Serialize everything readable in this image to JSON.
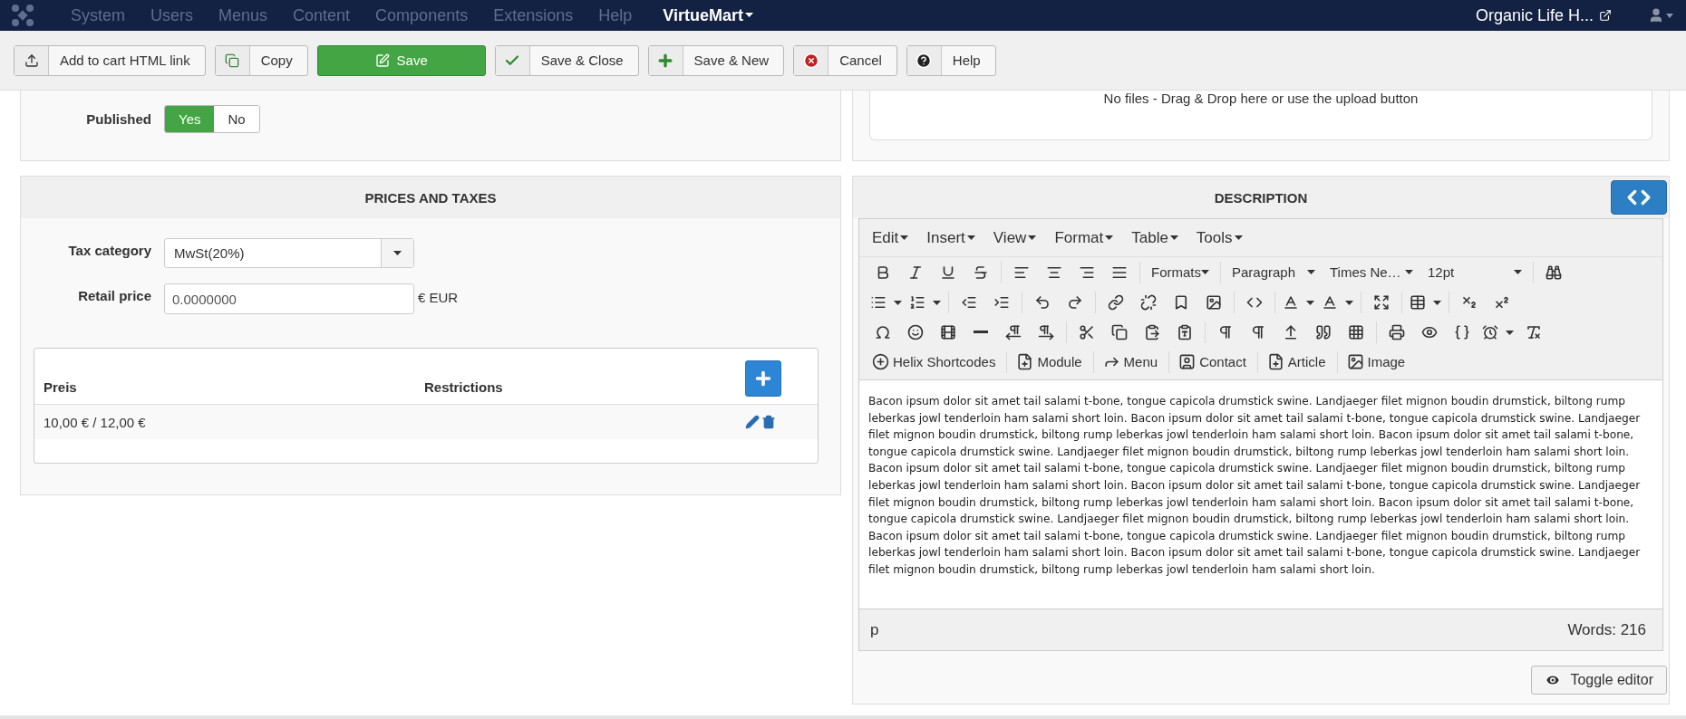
{
  "topbar": {
    "menu": [
      {
        "label": "System",
        "highlighted": false
      },
      {
        "label": "Users",
        "highlighted": false
      },
      {
        "label": "Menus",
        "highlighted": false
      },
      {
        "label": "Content",
        "highlighted": false
      },
      {
        "label": "Components",
        "highlighted": false
      },
      {
        "label": "Extensions",
        "highlighted": false
      },
      {
        "label": "Help",
        "highlighted": false
      },
      {
        "label": "VirtueMart",
        "highlighted": true
      }
    ],
    "site_link": "Organic Life H..."
  },
  "toolbar": [
    {
      "label": "Add to cart HTML link",
      "kind": "upload"
    },
    {
      "label": "Copy",
      "kind": "copy"
    },
    {
      "label": "Save",
      "kind": "save"
    },
    {
      "label": "Save & Close",
      "kind": "check"
    },
    {
      "label": "Save & New",
      "kind": "new"
    },
    {
      "label": "Cancel",
      "kind": "cancel"
    },
    {
      "label": "Help",
      "kind": "help"
    }
  ],
  "details": {
    "published": {
      "label": "Published",
      "options": [
        {
          "label": "Yes",
          "selected": true
        },
        {
          "label": "No",
          "selected": false
        }
      ]
    }
  },
  "prices_and_taxes": {
    "title": "PRICES AND TAXES",
    "tax_category": {
      "label": "Tax category",
      "value": "MwSt(20%)"
    },
    "retail_price": {
      "label": "Retail price",
      "value": "0.0000000",
      "unit": "€ EUR"
    },
    "price_table": {
      "columns": [
        "Preis",
        "Restrictions"
      ],
      "rows": [
        {
          "preis": "10,00 € / 12,00 €"
        }
      ]
    }
  },
  "files": {
    "dropzone": "No files - Drag & Drop here or use the upload button"
  },
  "description": {
    "title": "DESCRIPTION",
    "menus": [
      "Edit",
      "Insert",
      "View",
      "Format",
      "Table",
      "Tools"
    ],
    "formats": "Formats",
    "block": "Paragraph",
    "font": "Times Ne…",
    "size": "12pt",
    "plugins": [
      {
        "label": "Helix Shortcodes",
        "kind": "shortcodes"
      },
      {
        "label": "Module",
        "kind": "module"
      },
      {
        "label": "Menu",
        "kind": "menu"
      },
      {
        "label": "Contact",
        "kind": "contact"
      },
      {
        "label": "Article",
        "kind": "article"
      },
      {
        "label": "Image",
        "kind": "image"
      }
    ],
    "content": "Bacon ipsum dolor sit amet tail salami t-bone, tongue capicola drumstick swine. Landjaeger filet mignon boudin drumstick, biltong rump leberkas jowl tenderloin ham salami short loin. Bacon ipsum dolor sit amet tail salami t-bone, tongue capicola drumstick swine. Landjaeger filet mignon boudin drumstick, biltong rump leberkas jowl tenderloin ham salami short loin. Bacon ipsum dolor sit amet tail salami t-bone, tongue capicola drumstick swine. Landjaeger filet mignon boudin drumstick, biltong rump leberkas jowl tenderloin ham salami short loin. Bacon ipsum dolor sit amet tail salami t-bone, tongue capicola drumstick swine. Landjaeger filet mignon boudin drumstick, biltong rump leberkas jowl tenderloin ham salami short loin. Bacon ipsum dolor sit amet tail salami t-bone, tongue capicola drumstick swine. Landjaeger filet mignon boudin drumstick, biltong rump leberkas jowl tenderloin ham salami short loin. Bacon ipsum dolor sit amet tail salami t-bone, tongue capicola drumstick swine. Landjaeger filet mignon boudin drumstick, biltong rump leberkas jowl tenderloin ham salami short loin. Bacon ipsum dolor sit amet tail salami t-bone, tongue capicola drumstick swine. Landjaeger filet mignon boudin drumstick, biltong rump leberkas jowl tenderloin ham salami short loin. Bacon ipsum dolor sit amet tail salami t-bone, tongue capicola drumstick swine. Landjaeger filet mignon boudin drumstick, biltong rump leberkas jowl tenderloin ham salami short loin.",
    "path": "p",
    "word_count": "Words: 216",
    "toggle": "Toggle editor"
  }
}
